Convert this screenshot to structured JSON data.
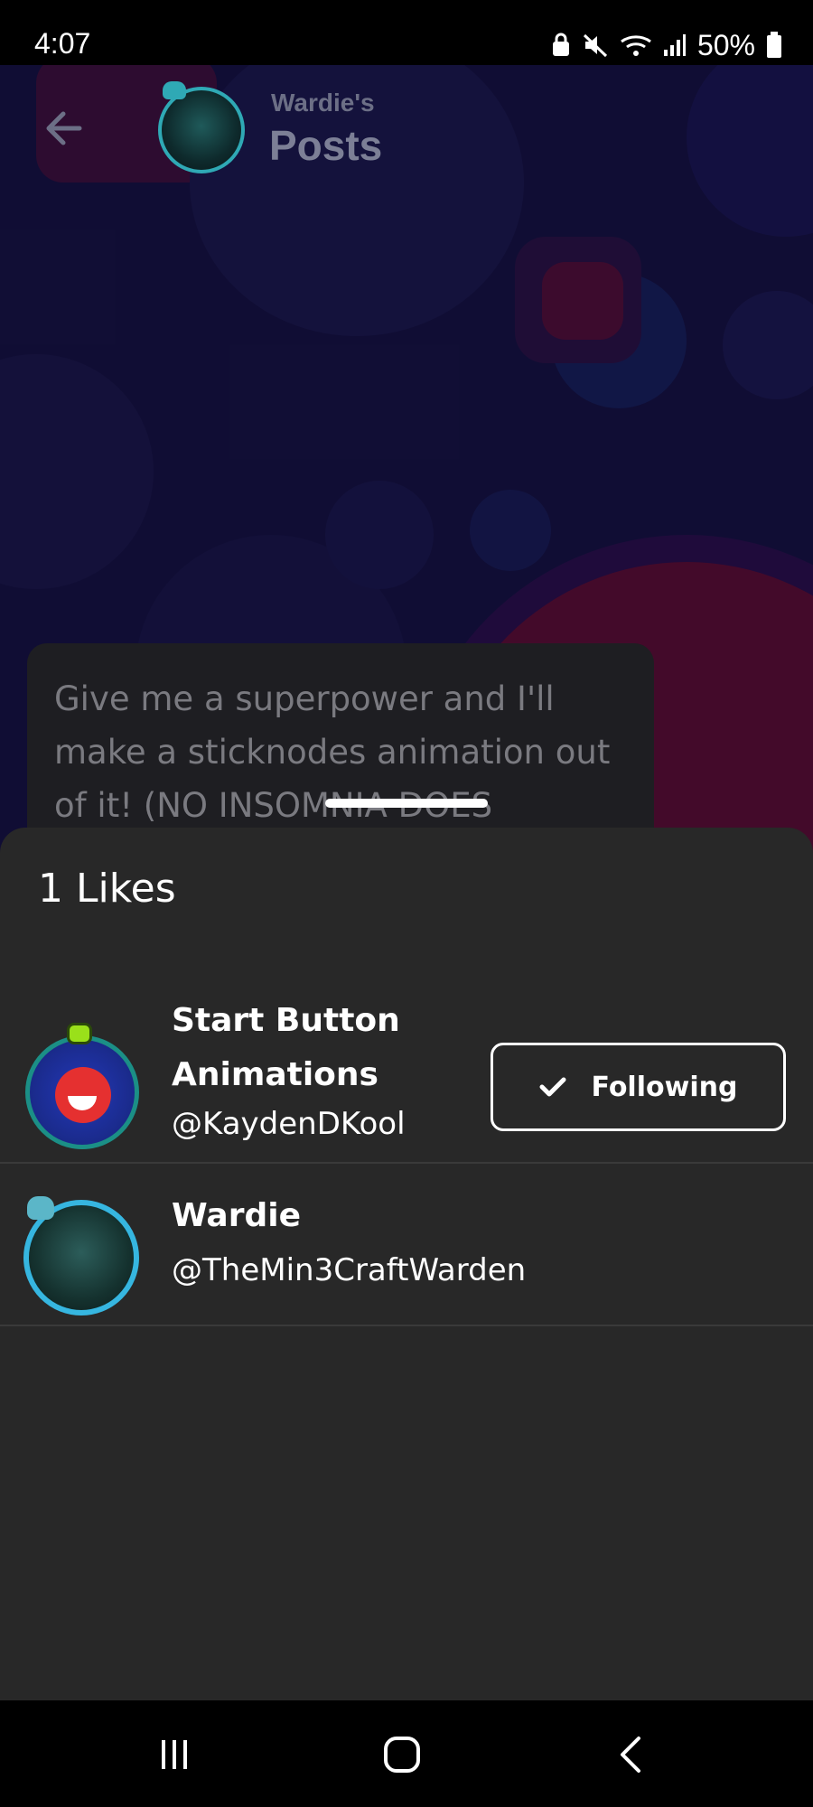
{
  "status_bar": {
    "time": "4:07",
    "battery": "50%",
    "icons": [
      "lock-screen-icon",
      "mute-icon",
      "wifi-icon",
      "signal-icon",
      "battery-icon"
    ]
  },
  "header": {
    "subtitle": "Wardie's",
    "title": "Posts",
    "back_icon": "arrow-left-icon"
  },
  "post": {
    "text": "Give me a superpower and I'll make a sticknodes animation out of it! (NO INSOMNIA DOES"
  },
  "likes_sheet": {
    "title": "1 Likes",
    "users": [
      {
        "name": "Start Button Animations",
        "handle": "@KaydenDKool",
        "button": "Following",
        "button_icon": "checkmark-icon"
      },
      {
        "name": "Wardie",
        "handle": "@TheMin3CraftWarden"
      }
    ]
  },
  "nav_bar": {
    "icons": [
      "recent-apps-icon",
      "home-icon",
      "back-icon"
    ]
  },
  "colors": {
    "sheet_bg": "#282828",
    "divider": "#3a3a3a",
    "background": "#1a1650",
    "accent_pink": "#8a0f3a",
    "avatar_ring_teal": "#36b6e0"
  }
}
